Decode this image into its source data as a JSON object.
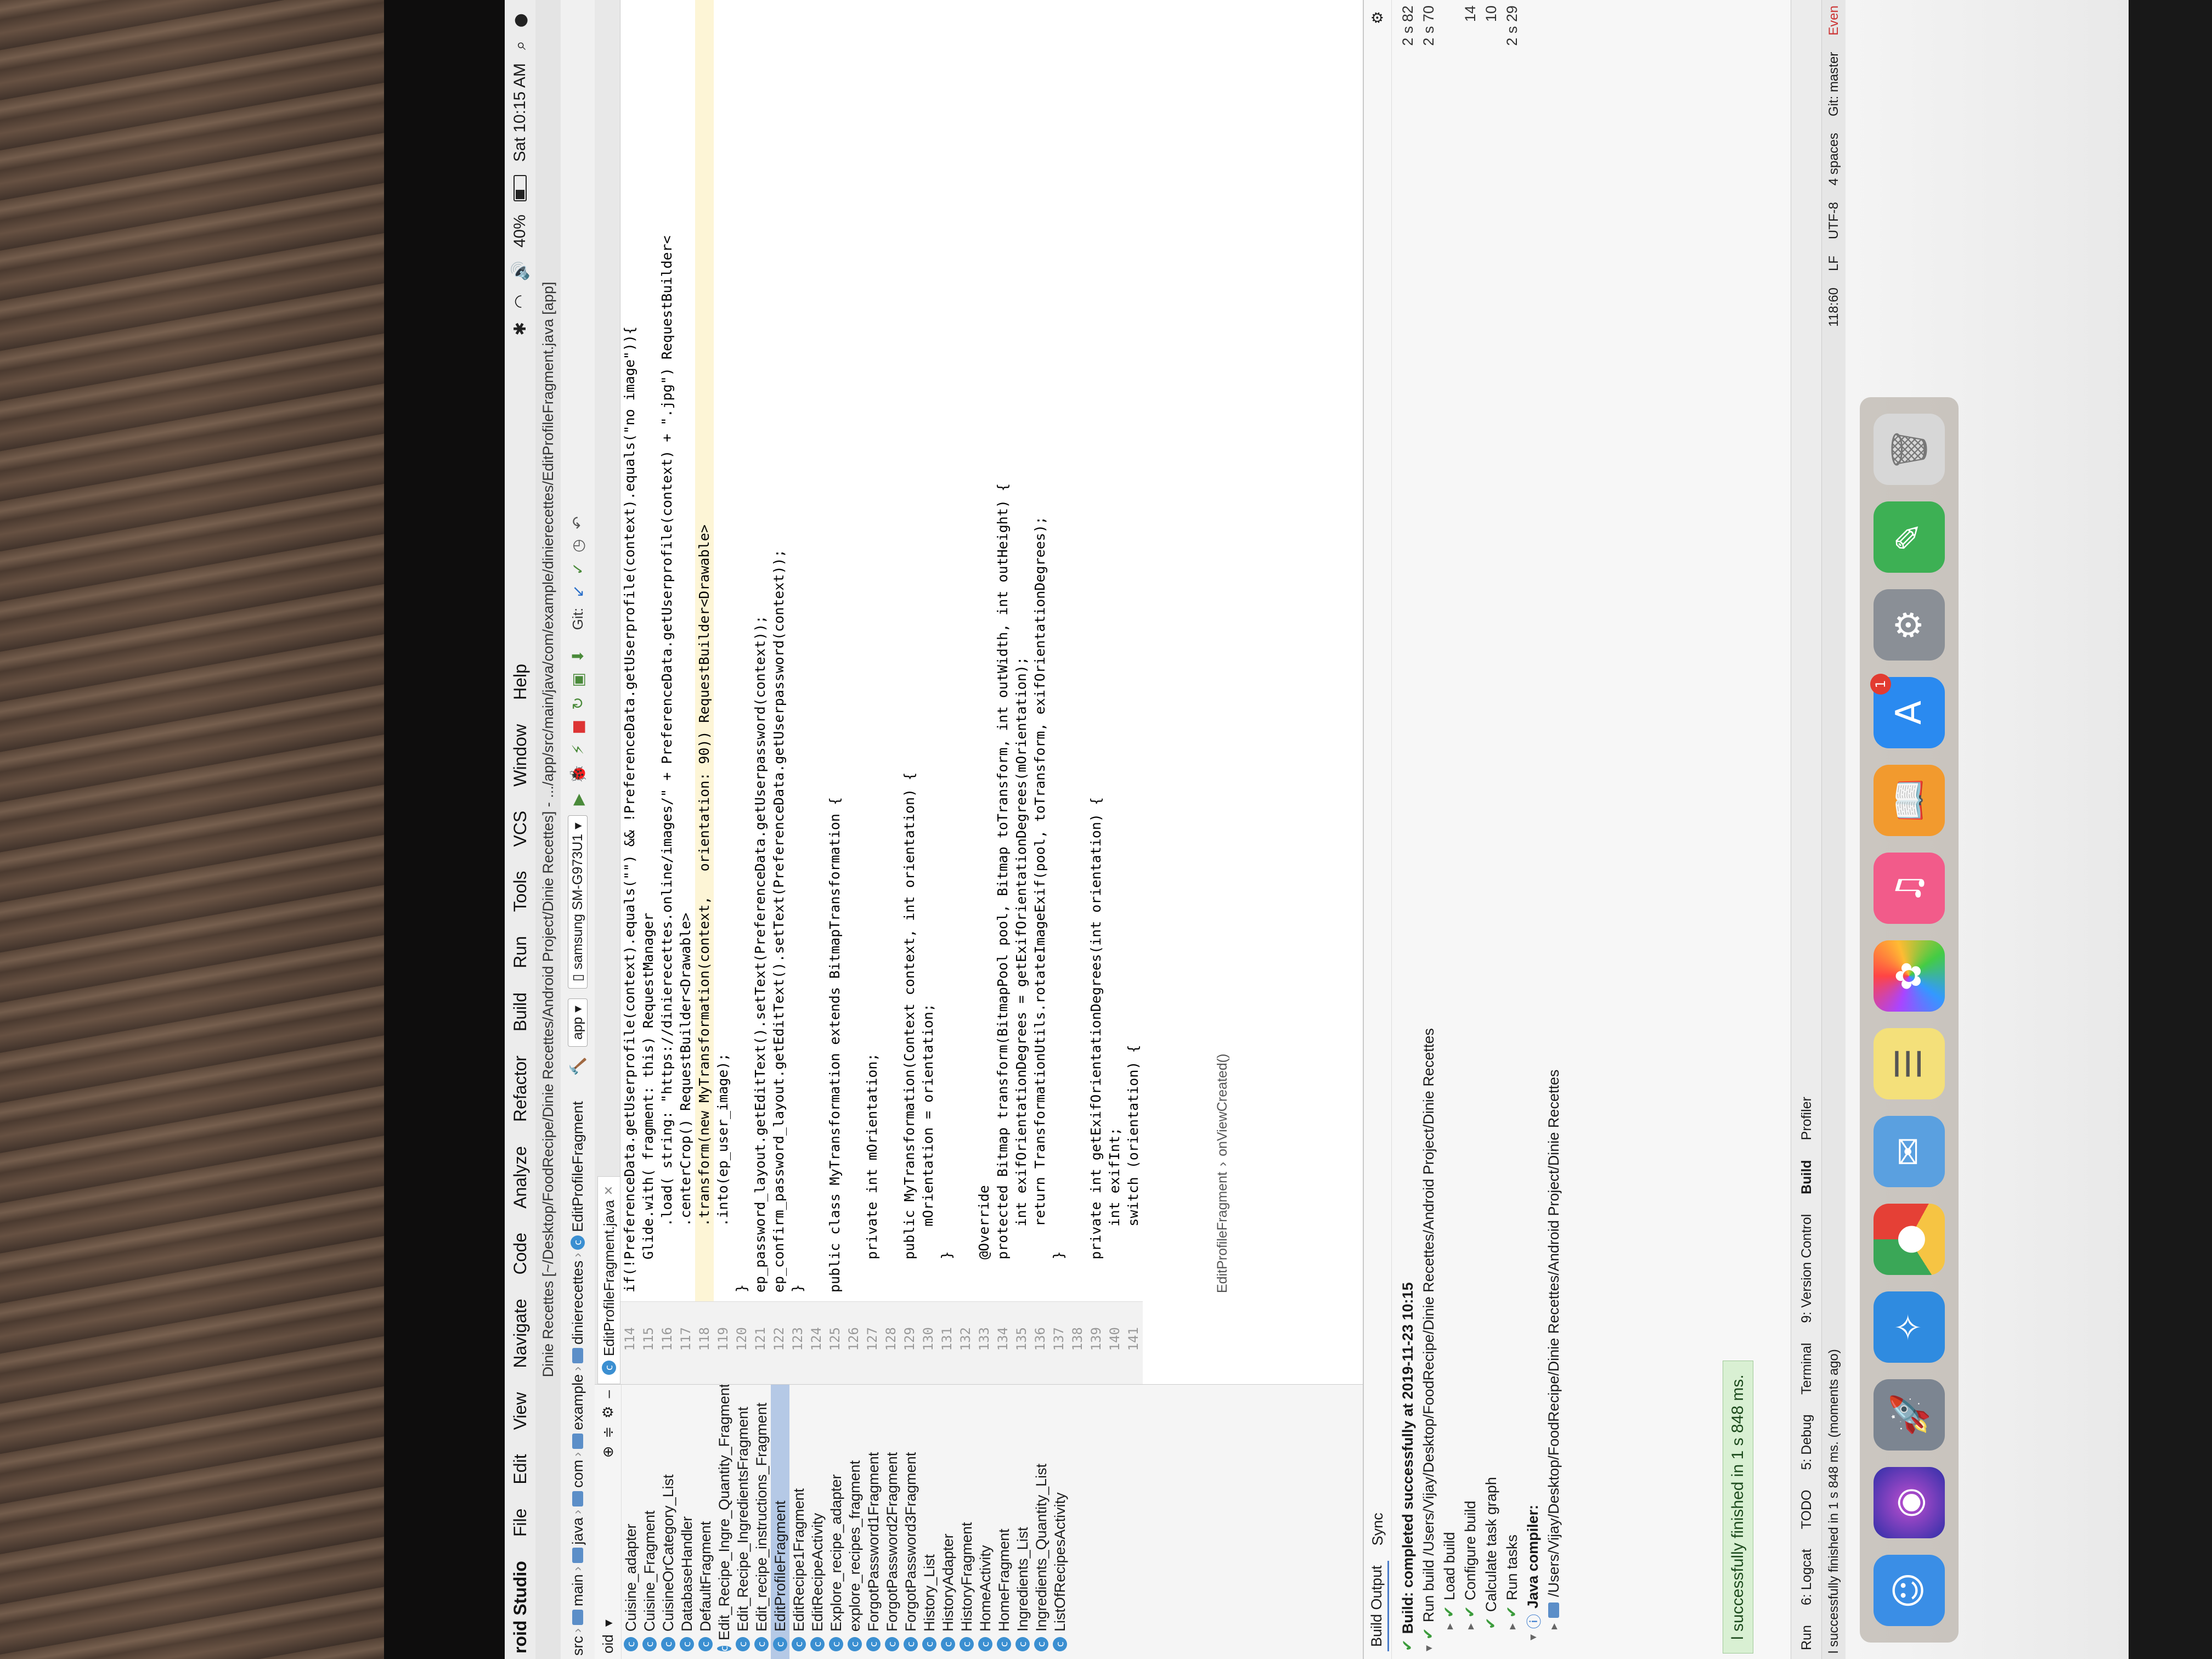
{
  "menubar": {
    "app_name": "roid Studio",
    "items": [
      "File",
      "Edit",
      "View",
      "Navigate",
      "Code",
      "Analyze",
      "Refactor",
      "Build",
      "Run",
      "Tools",
      "VCS",
      "Window",
      "Help"
    ],
    "battery": "40%",
    "clock": "Sat 10:15 AM"
  },
  "window": {
    "title": "Dinie Recettes [~/Desktop/FoodRecipe/Dinie Recettes/Android Project/Dinie Recettes] - .../app/src/main/java/com/example/dinierecettes/EditProfileFragment.java [app]"
  },
  "navbar": {
    "crumbs": [
      "src",
      "main",
      "java",
      "com",
      "example",
      "dinierecettes",
      "EditProfileFragment"
    ],
    "run_config": "app",
    "device": "samsung SM-G973U1",
    "git_label": "Git:"
  },
  "project": {
    "header": "oid",
    "items": [
      "Cuisine_adapter",
      "Cuisine_Fragment",
      "CuisineOrCategory_List",
      "DatabaseHandler",
      "DefaultFragment",
      "Edit_Recipe_Ingre_Quantity_Fragment",
      "Edit_Recipe_IngredientsFragment",
      "Edit_recipe_instructions_Fragment",
      "EditProfileFragment",
      "EditRecipe1Fragment",
      "EditRecipeActivity",
      "Explore_recipe_adapter",
      "explore_recipes_fragment",
      "ForgotPassword1Fragment",
      "ForgotPassword2Fragment",
      "ForgotPassword3Fragment",
      "History_List",
      "HistoryAdapter",
      "HistoryFragment",
      "HomeActivity",
      "HomeFragment",
      "Ingredients_List",
      "Ingredients_Quantity_List",
      "ListOfRecipesActivity"
    ],
    "selected_index": 8
  },
  "editor": {
    "tab": "EditProfileFragment.java",
    "lines": [
      {
        "n": "114",
        "code": "if(!PreferenceData.getUserprofile(context).equals(\"\") && !PreferenceData.getUserprofile(context).equals(\"no image\")){"
      },
      {
        "n": "115",
        "code": "    Glide.with( fragment: this) RequestManager"
      },
      {
        "n": "116",
        "code": "        .load( string: \"https://dinierecettes.online/images/\" + PreferenceData.getUserprofile(context) + \".jpg\") RequestBuilder<"
      },
      {
        "n": "117",
        "code": "        .centerCrop() RequestBuilder<Drawable>"
      },
      {
        "n": "118",
        "code": "        .transform(new MyTransformation(context,   orientation: 90)) RequestBuilder<Drawable>"
      },
      {
        "n": "119",
        "code": "        .into(ep_user_image);"
      },
      {
        "n": "120",
        "code": "}"
      },
      {
        "n": "121",
        "code": "ep_password_layout.getEditText().setText(PreferenceData.getUserpassword(context));"
      },
      {
        "n": "122",
        "code": "ep_confirm_password_layout.getEditText().setText(PreferenceData.getUserpassword(context));"
      },
      {
        "n": "123",
        "code": "}"
      },
      {
        "n": "124",
        "code": ""
      },
      {
        "n": "125",
        "code": "public class MyTransformation extends BitmapTransformation {"
      },
      {
        "n": "126",
        "code": ""
      },
      {
        "n": "127",
        "code": "    private int mOrientation;"
      },
      {
        "n": "128",
        "code": ""
      },
      {
        "n": "129",
        "code": "    public MyTransformation(Context context, int orientation) {"
      },
      {
        "n": "130",
        "code": "        mOrientation = orientation;"
      },
      {
        "n": "131",
        "code": "    }"
      },
      {
        "n": "132",
        "code": ""
      },
      {
        "n": "133",
        "code": "    @Override"
      },
      {
        "n": "134",
        "code": "    protected Bitmap transform(BitmapPool pool, Bitmap toTransform, int outWidth, int outHeight) {"
      },
      {
        "n": "135",
        "code": "        int exifOrientationDegrees = getExifOrientationDegrees(mOrientation);"
      },
      {
        "n": "136",
        "code": "        return TransformationUtils.rotateImageExif(pool, toTransform, exifOrientationDegrees);"
      },
      {
        "n": "137",
        "code": "    }"
      },
      {
        "n": "138",
        "code": ""
      },
      {
        "n": "139",
        "code": "    private int getExifOrientationDegrees(int orientation) {"
      },
      {
        "n": "140",
        "code": "        int exifInt;"
      },
      {
        "n": "141",
        "code": "        switch (orientation) {"
      }
    ],
    "breadcrumb": [
      "EditProfileFragment",
      "onViewCreated()"
    ]
  },
  "build": {
    "tabs": [
      "Build Output",
      "Sync"
    ],
    "rows": [
      {
        "text": "Build: completed successfully at 2019-11-23 10:15",
        "time": "2 s 82"
      },
      {
        "text": "Run build /Users/Vijay/Desktop/FoodRecipe/Dinie Recettes/Android Project/Dinie Recettes",
        "time": "2 s 70"
      },
      {
        "text": "Load build",
        "time": ""
      },
      {
        "text": "Configure build",
        "time": "14"
      },
      {
        "text": "Calculate task graph",
        "time": "10"
      },
      {
        "text": "Run tasks",
        "time": "2 s 29"
      },
      {
        "text": "Java compiler:",
        "time": ""
      },
      {
        "text": "/Users/Vijay/Desktop/FoodRecipe/Dinie Recettes/Android Project/Dinie Recettes",
        "time": ""
      }
    ],
    "toast": "l successfully finished in 1 s 848 ms."
  },
  "tooltabs": [
    "Run",
    "6: Logcat",
    "TODO",
    "5: Debug",
    "Terminal",
    "9: Version Control",
    "Build",
    "Profiler"
  ],
  "status": {
    "left": "l successfully finished in 1 s 848 ms. (moments ago)",
    "position": "118:60",
    "line_sep": "LF",
    "encoding": "UTF-8",
    "indent": "4 spaces",
    "git": "Git: master",
    "event": "Even"
  },
  "dock": {
    "badge": "1"
  }
}
